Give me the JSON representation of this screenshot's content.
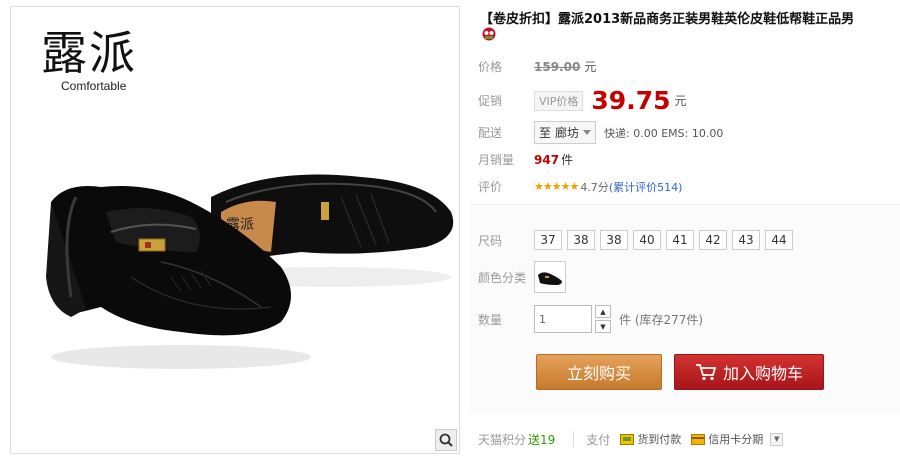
{
  "product_image": {
    "brand_cn": "露派",
    "brand_en": "Comfortable",
    "shoe_mark": "露派",
    "zoom_icon": "magnifier-icon"
  },
  "title": "【卷皮折扣】露派2013新品商务正装男鞋英伦皮鞋低帮鞋正品男",
  "price": {
    "label": "价格",
    "original": "159.00",
    "unit": "元"
  },
  "promo": {
    "label": "促销",
    "tag": "VIP价格",
    "price": "39.75",
    "unit": "元"
  },
  "delivery": {
    "label": "配送",
    "to": "至",
    "city": "廊坊",
    "detail": "快递: 0.00 EMS: 10.00"
  },
  "monthly_sales": {
    "label": "月销量",
    "count": "947",
    "unit": "件"
  },
  "rating": {
    "label": "评价",
    "stars": "★★★★★",
    "score": "4.7分",
    "reviews_link": "(累计评价514)"
  },
  "size": {
    "label": "尺码",
    "options": [
      "37",
      "38",
      "38",
      "40",
      "41",
      "42",
      "43",
      "44"
    ]
  },
  "color": {
    "label": "颜色分类"
  },
  "quantity": {
    "label": "数量",
    "value": "1",
    "stock": "件 (库存277件)"
  },
  "buttons": {
    "buy_now": "立刻购买",
    "add_cart": "加入购物车"
  },
  "footer": {
    "points_label": "天猫积分",
    "points_value": "送19",
    "pay_label": "支付",
    "pay_cod": "货到付款",
    "pay_credit": "信用卡分期"
  },
  "colors": {
    "price_red": "#c40000",
    "buy_orange": "#d4883e",
    "cart_red": "#c0201f",
    "star": "#e8a200"
  }
}
